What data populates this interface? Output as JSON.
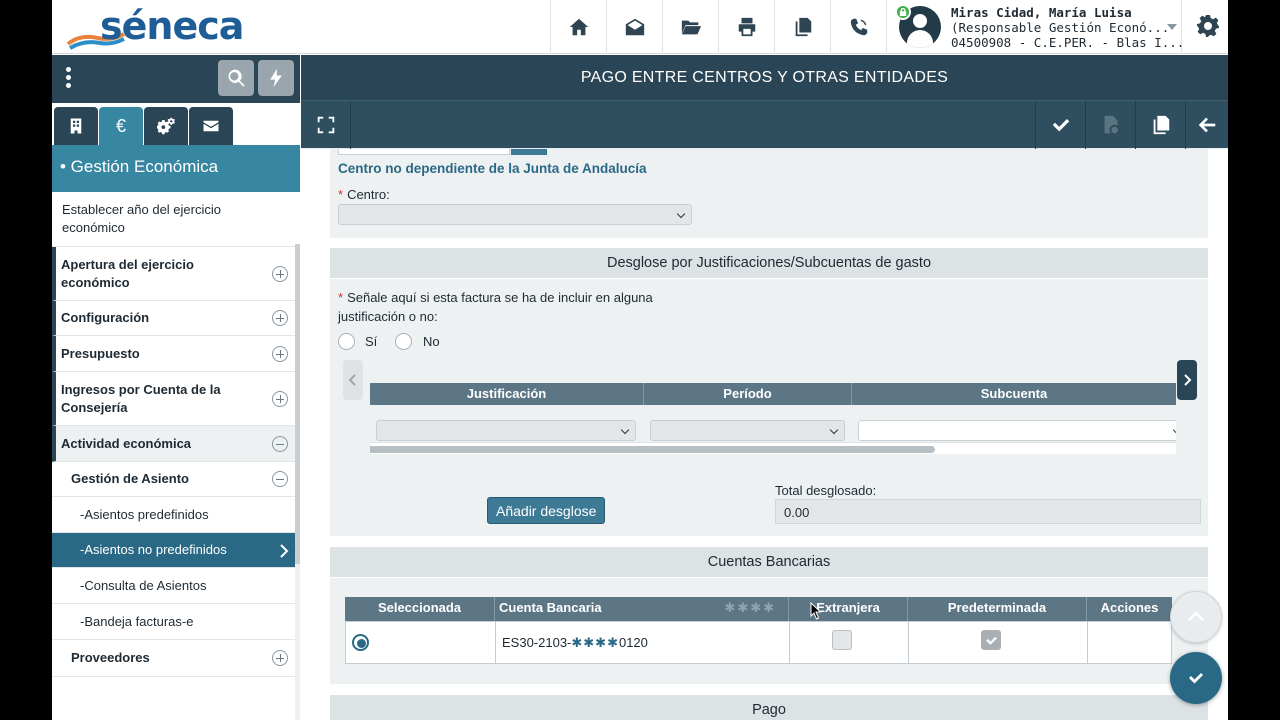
{
  "app": {
    "logo_text": "séneca",
    "page_title": "PAGO ENTRE CENTROS Y OTRAS ENTIDADES"
  },
  "user": {
    "name": "Miras Cidad, María Luisa",
    "role": "(Responsable Gestión Econó...",
    "center": "04500908 - C.E.PER. - Blas I..."
  },
  "nav_icons": [
    "home-icon",
    "mail-icon",
    "folder-icon",
    "print-icon",
    "copy-icon",
    "phone-icon"
  ],
  "sidebar": {
    "section_title": "• Gestión Económica",
    "tab_euro": "€",
    "items": [
      {
        "label": "Establecer año del ejercicio económico"
      },
      {
        "label": "Apertura del ejercicio económico"
      },
      {
        "label": "Configuración"
      },
      {
        "label": "Presupuesto"
      },
      {
        "label": "Ingresos por Cuenta de la Consejería"
      },
      {
        "label": "Actividad económica"
      },
      {
        "label": "Gestión de Asiento"
      },
      {
        "label": "-Asientos predefinidos"
      },
      {
        "label": "-Asientos no predefinidos"
      },
      {
        "label": "-Consulta de Asientos"
      },
      {
        "label": "-Bandeja facturas-e"
      },
      {
        "label": "Proveedores"
      }
    ]
  },
  "form": {
    "centro_section_label": "Centro no dependiente de la Junta de Andalucía",
    "centro_label": "Centro:",
    "desglose_header": "Desglose por Justificaciones/Subcuentas de gasto",
    "justificacion_question": "Señale aquí si esta factura se ha de incluir en alguna justificación o no:",
    "radio_si": "Sí",
    "radio_no": "No",
    "grid_columns": [
      "Justificación",
      "Período",
      "Subcuenta"
    ],
    "add_button": "Añadir desglose",
    "total_label": "Total desglosado:",
    "total_value": "0.00",
    "cuentas_header": "Cuentas Bancarias",
    "cuentas_columns": [
      "Seleccionada",
      "Cuenta Bancaria",
      "Extranjera",
      "Predeterminada",
      "Acciones"
    ],
    "cuenta_mask_header": "✱✱✱✱",
    "cuenta_prefix": "ES30-2103-",
    "cuenta_mask": "✱✱✱✱",
    "cuenta_suffix": "0120",
    "pago_header": "Pago"
  },
  "colors": {
    "dark_header": "#2a4555",
    "accent": "#3887a2",
    "active_item": "#2a6985"
  }
}
